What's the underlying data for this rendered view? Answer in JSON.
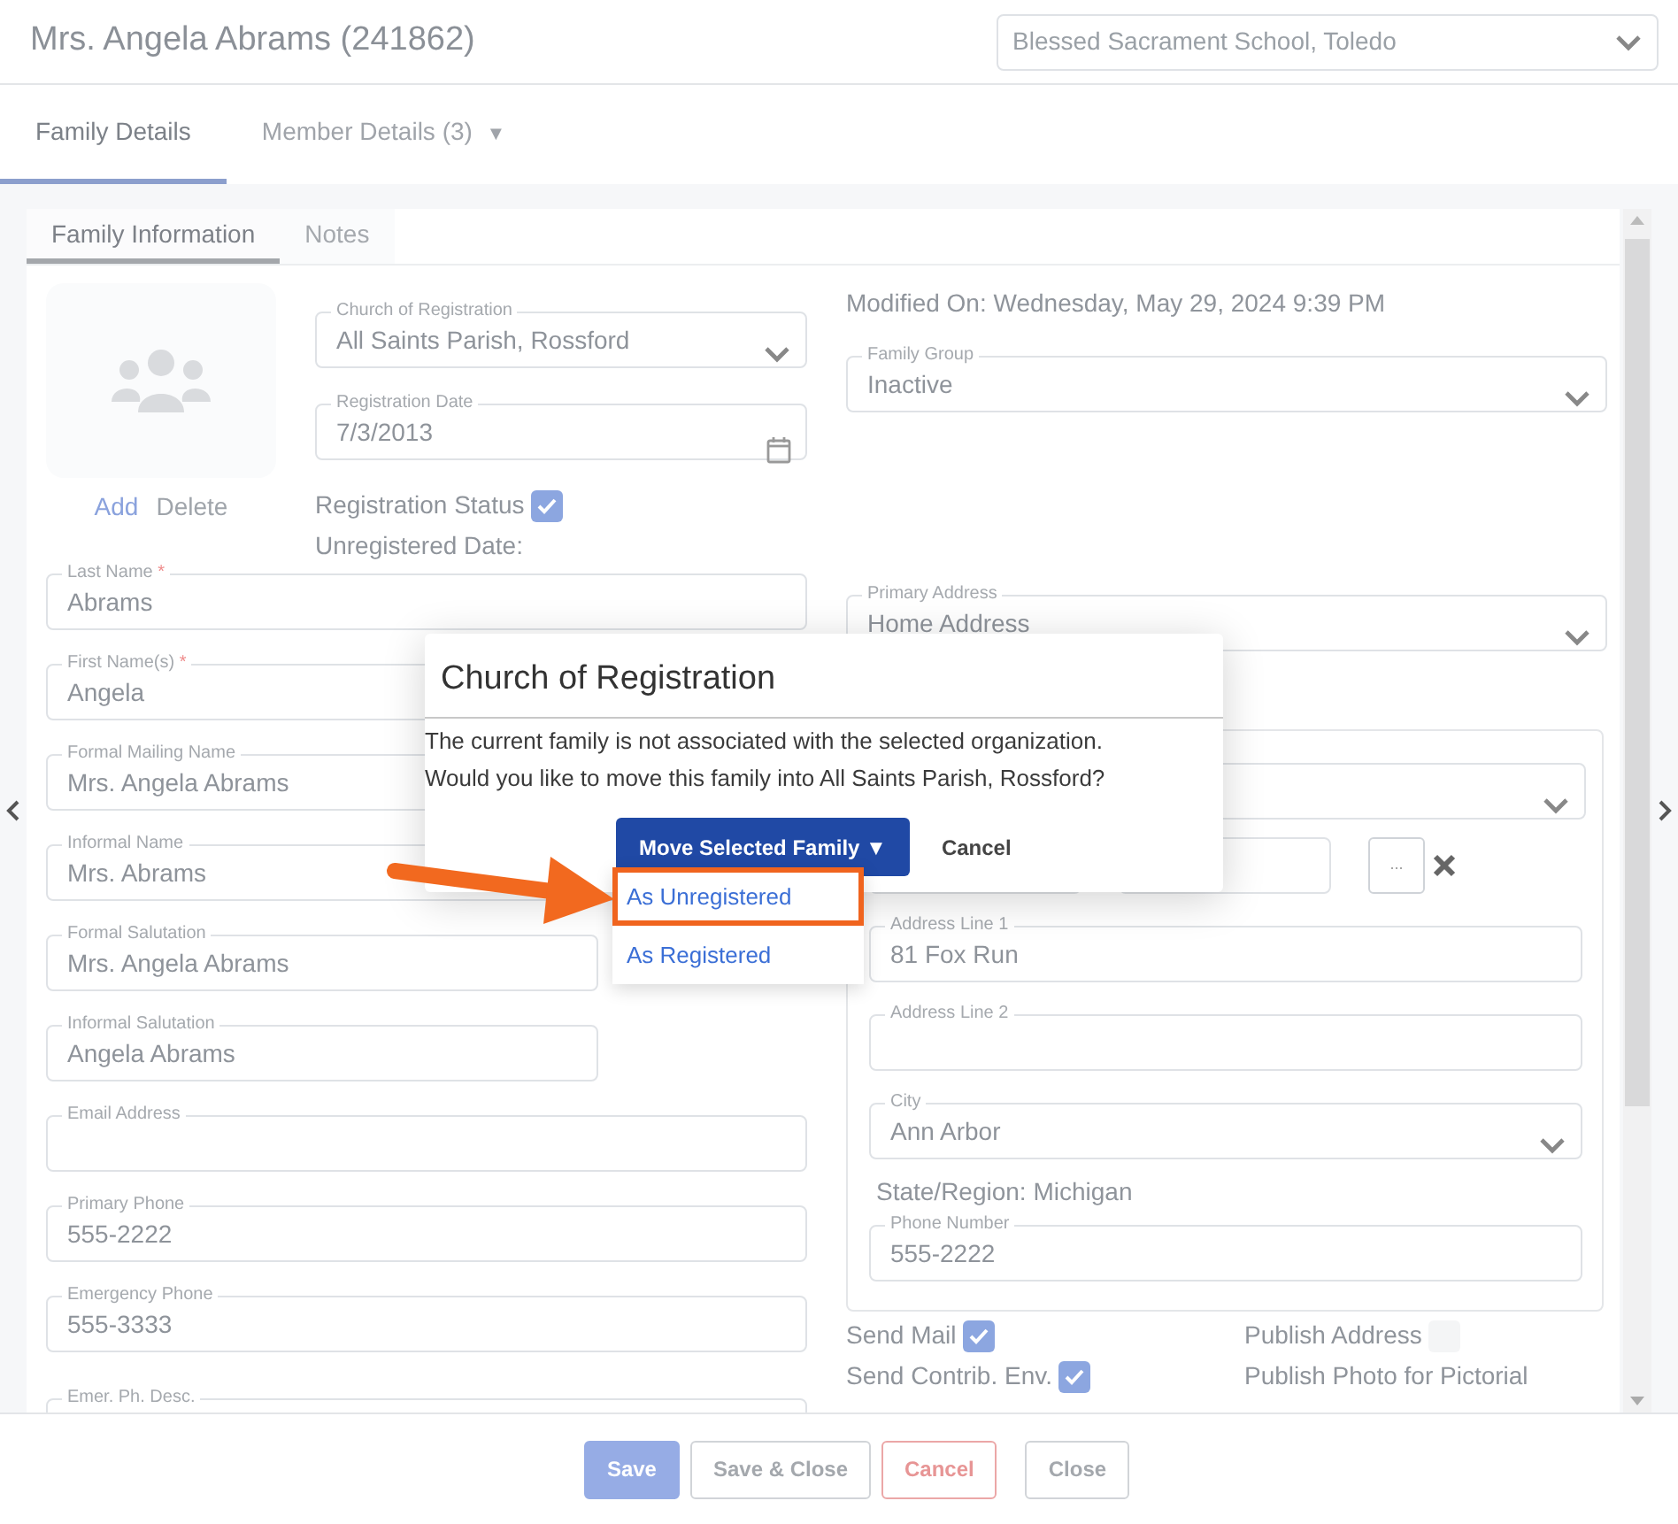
{
  "header": {
    "title": "Mrs. Angela Abrams (241862)",
    "organization": "Blessed Sacrament School, Toledo"
  },
  "tabs": [
    {
      "label": "Family Details",
      "selected": true
    },
    {
      "label": "Member Details (3)",
      "selected": false,
      "caret": "▼"
    }
  ],
  "subtabs": [
    {
      "label": "Family Information",
      "selected": true
    },
    {
      "label": "Notes",
      "selected": false
    }
  ],
  "photo_actions": [
    {
      "label": "Add",
      "disabled": false
    },
    {
      "label": "Delete",
      "disabled": true
    }
  ],
  "registration": {
    "fields": [
      {
        "kind": "select",
        "label": "Church of Registration",
        "value": "All Saints Parish, Rossford"
      },
      {
        "kind": "date",
        "label": "Registration Date",
        "value": "7/3/2013"
      }
    ],
    "status_label": "Registration Status",
    "status_checked": true,
    "unregistered_label": "Unregistered Date:"
  },
  "left_fields": [
    {
      "kind": "text",
      "label": "Last Name",
      "required_mark": "*",
      "value": "Abrams"
    },
    {
      "kind": "text",
      "label": "First Name(s)",
      "required_mark": "*",
      "value": "Angela"
    },
    {
      "kind": "text",
      "label": "Formal Mailing Name",
      "value": "Mrs. Angela Abrams"
    },
    {
      "kind": "text",
      "label": "Informal Name",
      "value": "Mrs. Abrams"
    },
    {
      "kind": "short",
      "label": "Formal Salutation",
      "value": "Mrs. Angela Abrams"
    },
    {
      "kind": "short",
      "label": "Informal Salutation",
      "value": "Angela Abrams"
    },
    {
      "kind": "text",
      "label": "Email Address"
    },
    {
      "kind": "text",
      "label": "Primary Phone",
      "value": "555-2222"
    },
    {
      "kind": "text",
      "label": "Emergency Phone",
      "value": "555-3333"
    },
    {
      "kind": "text",
      "label": "Emer. Ph. Desc."
    }
  ],
  "modified": "Modified On: Wednesday, May 29, 2024 9:39 PM",
  "family_group": {
    "kind": "select",
    "label": "Family Group",
    "value": "Inactive"
  },
  "primary_address": {
    "kind": "select",
    "label": "Primary Address",
    "value": "Home Address"
  },
  "address": {
    "lookup_button": "...",
    "lines": [
      {
        "kind": "text",
        "label": "Address Line 1",
        "value": "81 Fox Run"
      },
      {
        "kind": "text",
        "label": "Address Line 2"
      },
      {
        "kind": "select",
        "label": "City",
        "value": "Ann Arbor"
      }
    ],
    "state": "State/Region: Michigan",
    "phone": {
      "kind": "text",
      "label": "Phone Number",
      "value": "555-2222"
    }
  },
  "options": [
    {
      "kind": "checkbox",
      "label": "Send Mail",
      "checked": true
    },
    {
      "kind": "checkbox",
      "label": "Publish Address",
      "checked": false
    },
    {
      "kind": "checkbox",
      "label": "Send Contrib. Env.",
      "checked": true
    },
    {
      "kind": "text",
      "label": "Publish Photo for Pictorial"
    }
  ],
  "footer_buttons": [
    {
      "kind": "primary",
      "label": "Save",
      "disabled": true
    },
    {
      "kind": "secondary",
      "label": "Save & Close",
      "disabled": false
    },
    {
      "kind": "danger",
      "label": "Cancel",
      "disabled": false
    },
    {
      "kind": "secondary",
      "label": "Close",
      "disabled": false
    }
  ],
  "modal": {
    "title": "Church of Registration",
    "message": [
      "The current family is not associated with the selected organization.",
      "Would you like to move this family into All Saints Parish, Rossford?"
    ],
    "primary": "Move Selected Family ▼",
    "cancel": "Cancel",
    "menu": [
      {
        "label": "As Unregistered",
        "highlighted": true
      },
      {
        "label": "As Registered",
        "highlighted": false
      }
    ]
  }
}
